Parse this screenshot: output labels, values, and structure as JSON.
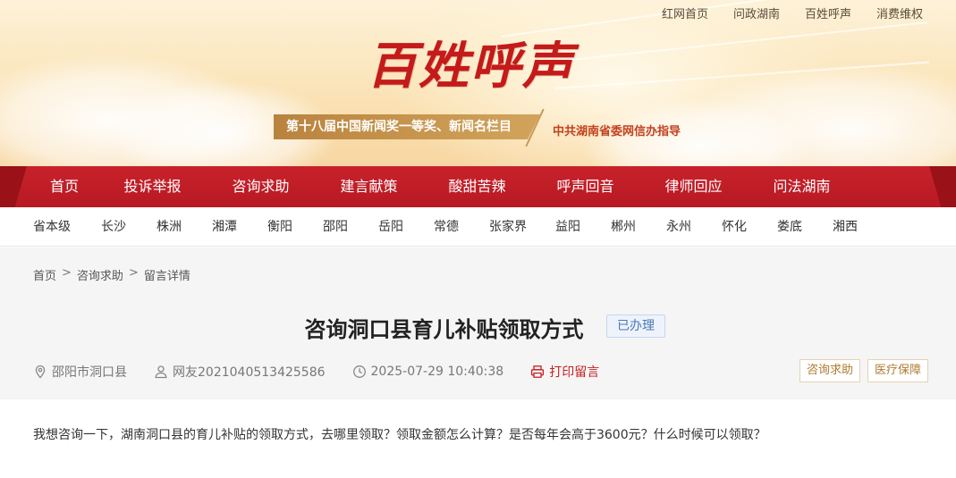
{
  "top_links": [
    "红网首页",
    "问政湖南",
    "百姓呼声",
    "消费维权"
  ],
  "banner": {
    "title": "百姓呼声",
    "award": "第十八届中国新闻奖一等奖、新闻名栏目",
    "guidance": "中共湖南省委网信办指导"
  },
  "main_nav": [
    "首页",
    "投诉举报",
    "咨询求助",
    "建言献策",
    "酸甜苦辣",
    "呼声回音",
    "律师回应",
    "问法湖南"
  ],
  "city_nav": [
    "省本级",
    "长沙",
    "株洲",
    "湘潭",
    "衡阳",
    "邵阳",
    "岳阳",
    "常德",
    "张家界",
    "益阳",
    "郴州",
    "永州",
    "怀化",
    "娄底",
    "湘西"
  ],
  "breadcrumb": {
    "items": [
      "首页",
      "咨询求助",
      "留言详情"
    ],
    "separator": ">"
  },
  "post": {
    "title": "咨询洞口县育儿补贴领取方式",
    "status": "已办理",
    "location": "邵阳市洞口县",
    "author": "网友2021040513425586",
    "datetime": "2025-07-29 10:40:38",
    "print_label": "打印留言",
    "tags": [
      "咨询求助",
      "医疗保障"
    ],
    "body": "我想咨询一下，湖南洞口县的育儿补贴的领取方式，去哪里领取？领取金额怎么计算？是否每年会高于3600元？什么时候可以领取？"
  },
  "colors": {
    "nav_red": "#c8222c",
    "accent_red": "#c6201f",
    "status_blue": "#4a77b7",
    "tag_gold": "#b07b32"
  },
  "icons": [
    "location-pin-icon",
    "user-icon",
    "clock-icon",
    "printer-icon"
  ]
}
